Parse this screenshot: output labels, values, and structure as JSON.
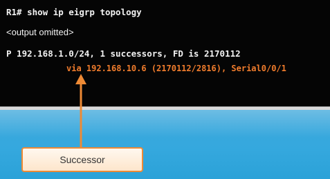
{
  "terminal": {
    "command": "R1# show ip eigrp topology",
    "omitted": "<output omitted>",
    "route": "P 192.168.1.0/24, 1 successors, FD is 2170112",
    "via": "via 192.168.10.6 (2170112/2816), Serial0/0/1"
  },
  "callout": {
    "label": "Successor"
  },
  "colors": {
    "terminal_bg": "#050505",
    "terminal_text": "#f2f2f2",
    "highlight": "#f07c2c",
    "desktop": "#35a8de"
  },
  "icons": {
    "arrow": "arrow-up-icon"
  }
}
